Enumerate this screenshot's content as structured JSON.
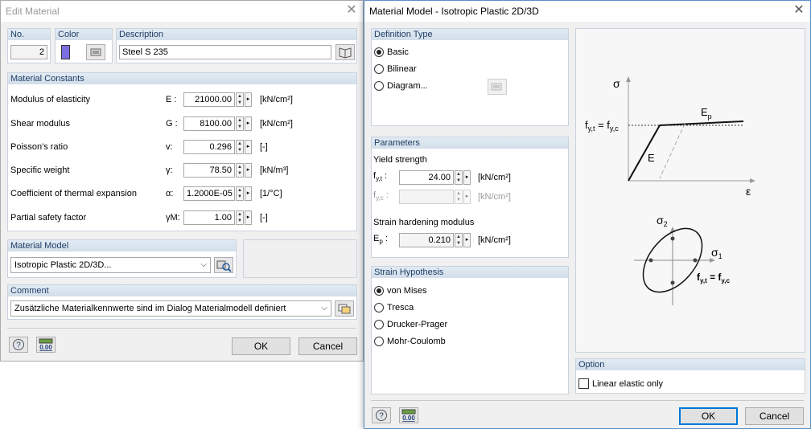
{
  "edit": {
    "title": "Edit Material",
    "no_label": "No.",
    "no_value": "2",
    "color_label": "Color",
    "color_swatch": "#7b6ee0",
    "desc_label": "Description",
    "desc_value": "Steel S 235",
    "constants_header": "Material Constants",
    "constants": [
      {
        "label": "Modulus of elasticity",
        "sym": "E :",
        "value": "21000.00",
        "unit": "[kN/cm²]"
      },
      {
        "label": "Shear modulus",
        "sym": "G :",
        "value": "8100.00",
        "unit": "[kN/cm²]"
      },
      {
        "label": "Poisson's ratio",
        "sym": "v:",
        "value": "0.296",
        "unit": "[-]"
      },
      {
        "label": "Specific weight",
        "sym": "γ:",
        "value": "78.50",
        "unit": "[kN/m³]"
      },
      {
        "label": "Coefficient of thermal expansion",
        "sym": "α:",
        "value": "1.2000E-05",
        "unit": "[1/°C]"
      },
      {
        "label": "Partial safety factor",
        "sym": "γM:",
        "value": "1.00",
        "unit": "[-]"
      }
    ],
    "model_header": "Material Model",
    "model_value": "Isotropic Plastic 2D/3D...",
    "comment_header": "Comment",
    "comment_value": "Zusätzliche Materialkennwerte sind im Dialog Materialmodell definiert",
    "ok": "OK",
    "cancel": "Cancel",
    "calc_icon_text": "0.00"
  },
  "model": {
    "title": "Material Model - Isotropic Plastic 2D/3D",
    "def_header": "Definition Type",
    "def_options": [
      "Basic",
      "Bilinear",
      "Diagram..."
    ],
    "def_selected": 0,
    "params_header": "Parameters",
    "yield_label": "Yield strength",
    "fyt_label": "f",
    "fyt_sub": "y,t",
    "fyt_value": "24.00",
    "fyt_unit": "[kN/cm²]",
    "fyc_label": "f",
    "fyc_sub": "y,c",
    "fyc_value": "",
    "fyc_unit": "[kN/cm²]",
    "hard_label": "Strain hardening modulus",
    "ep_label": "E",
    "ep_sub": "p",
    "ep_value": "0.210",
    "ep_unit": "[kN/cm²]",
    "strain_header": "Strain Hypothesis",
    "strain_options": [
      "von Mises",
      "Tresca",
      "Drucker-Prager",
      "Mohr-Coulomb"
    ],
    "strain_selected": 0,
    "option_header": "Option",
    "linear_label": "Linear elastic only",
    "ok": "OK",
    "cancel": "Cancel",
    "calc_icon_text": "0.00",
    "diagram": {
      "sigma": "σ",
      "eps": "ε",
      "fyt_eq": "f",
      "fyt_eq_sub1": "y,t",
      "fyt_eq_mid": " = f",
      "fyt_eq_sub2": "y,c",
      "ep": "E",
      "ep_sub": "p",
      "e": "E",
      "sigma2": "σ",
      "sigma2_sub": "2",
      "sigma1": "σ",
      "sigma1_sub": "1",
      "fy_eq2": "f",
      "fy_eq2_sub1": "y,t",
      "fy_eq2_mid": " = f",
      "fy_eq2_sub2": "y,c"
    }
  }
}
